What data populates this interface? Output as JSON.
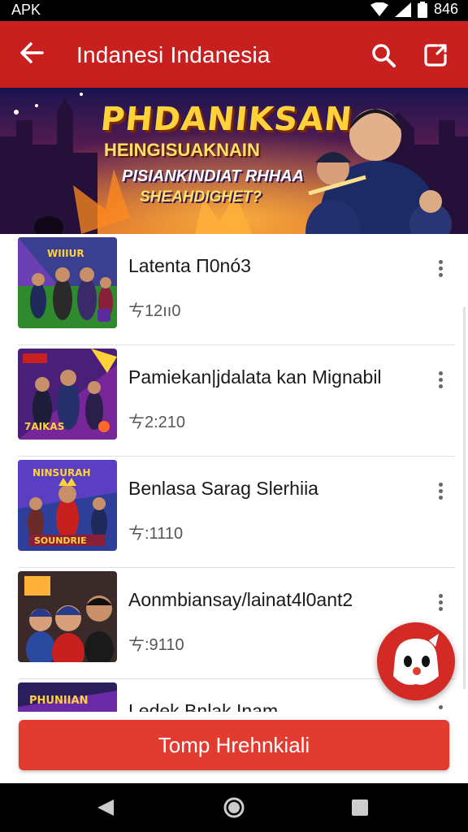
{
  "status_bar": {
    "carrier": "APK",
    "time": "846"
  },
  "app_bar": {
    "title": "Indanesi Indanesia"
  },
  "banner": {
    "line1": "PHDANIKSAN",
    "line2": "HEINGISUAKNAIN",
    "line3": "PISIANKINDIAT RHHAA",
    "line4": "SHEAHDIGHET?"
  },
  "list": {
    "items": [
      {
        "title": "Latenta Π0nó3",
        "subtitle": "ㄘ12ıı0"
      },
      {
        "title": "Pamiekan|jdalata kan Mignabil",
        "subtitle": "ㄘ2:210"
      },
      {
        "title": "Benlasa Sarag Slerhiia",
        "subtitle": "ㄘ:1110"
      },
      {
        "title": "Aonmbiansay/lainat4l0ant2",
        "subtitle": "ㄘ:9110"
      },
      {
        "title": "Ledek Bnlak Inam",
        "subtitle": ""
      }
    ]
  },
  "bottom": {
    "button_label": "Tomp Hrehnkiali"
  },
  "colors": {
    "primary": "#c8201e",
    "button": "#e23c30"
  }
}
